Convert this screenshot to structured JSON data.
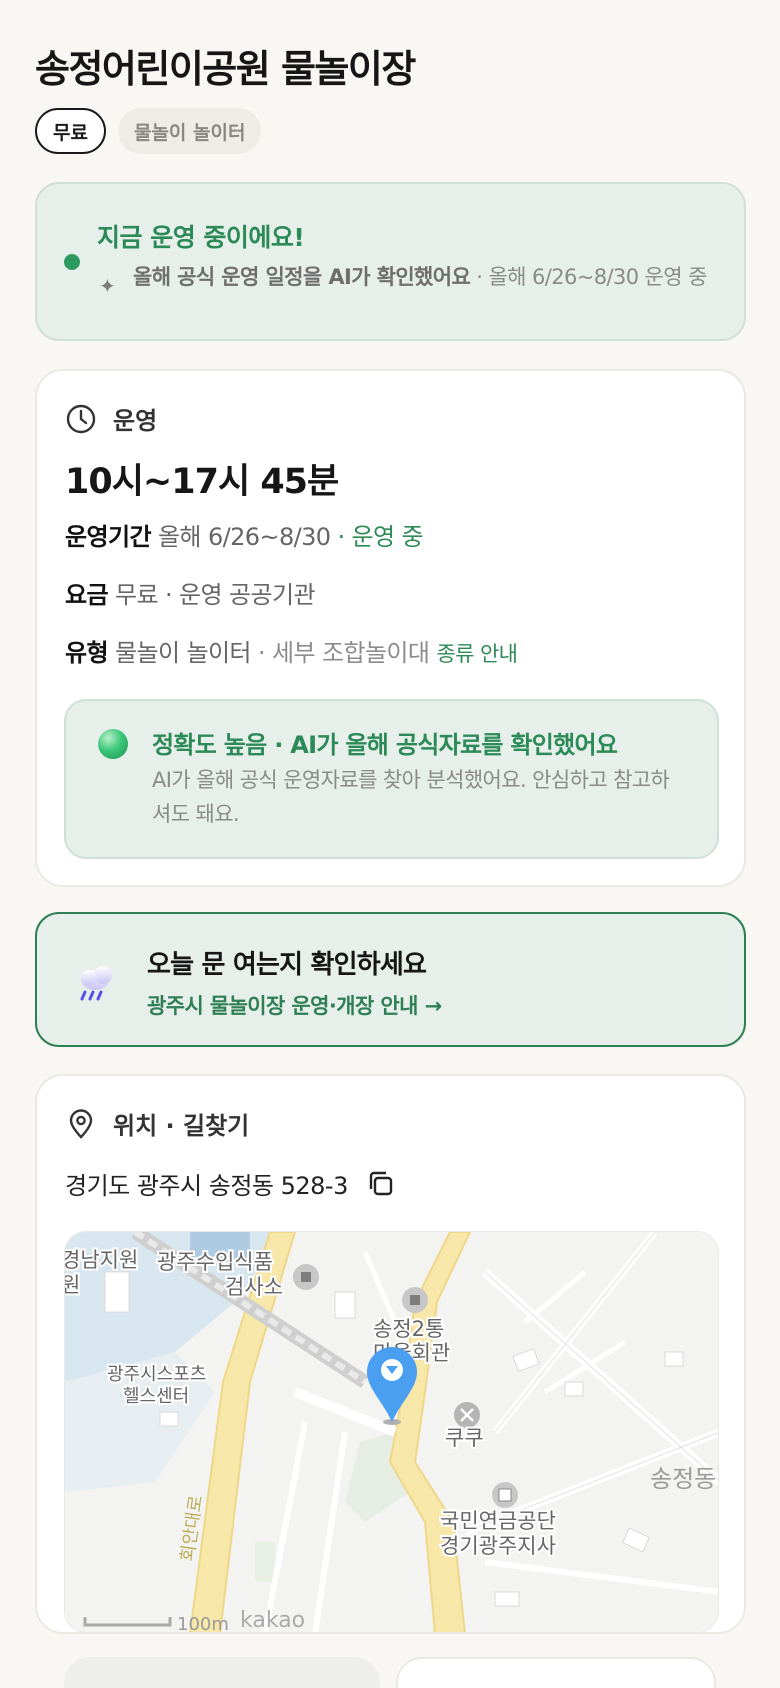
{
  "header": {
    "title": "송정어린이공원 물놀이장",
    "chips": [
      "무료",
      "물놀이 놀이터"
    ]
  },
  "status": {
    "title": "지금 운영 중이에요!",
    "desc_bold": "올해 공식 운영 일정을 AI가 확인했어요",
    "desc_rest": " · 올해 6/26~8/30 운영 중"
  },
  "operation": {
    "section_label": "운영",
    "hours": "10시~17시 45분",
    "period_label": "운영기간",
    "period_value": "올해 6/26~8/30",
    "period_status": " · 운영 중",
    "fee_label": "요금",
    "fee_value": "무료 · 운영 공공기관",
    "type_label": "유형",
    "type_value": "물놀이 놀이터",
    "type_detail": " · 세부 조합놀이대",
    "type_link": "종류 안내",
    "accuracy_title": "정확도 높음 · AI가 올해 공식자료를 확인했어요",
    "accuracy_desc": "AI가 올해 공식 운영자료를 찾아 분석했어요. 안심하고 참고하셔도 돼요."
  },
  "notice": {
    "title": "오늘 문 여는지 확인하세요",
    "link": "광주시 물놀이장 운영·개장 안내 →"
  },
  "location": {
    "section_label": "위치 · 길찾기",
    "address": "경기도 광주시 송정동 528-3"
  },
  "map": {
    "labels": {
      "l1": "경남지원",
      "l1b": "원",
      "l2": "광주수입식품",
      "l2b": "검사소",
      "l3": "송정2통",
      "l3b": "마을회관",
      "l4": "광주시스포츠",
      "l4b": "헬스센터",
      "l5": "쿠쿠",
      "l6": "국민연금공단",
      "l6b": "경기광주지사",
      "l7": "송정동",
      "road": "회안대로",
      "scale": "100m",
      "brand": "kakao"
    }
  },
  "colors": {
    "accent_green": "#2f8a58",
    "status_bg": "#e6efe9",
    "marker_blue": "#4a9ff0"
  }
}
